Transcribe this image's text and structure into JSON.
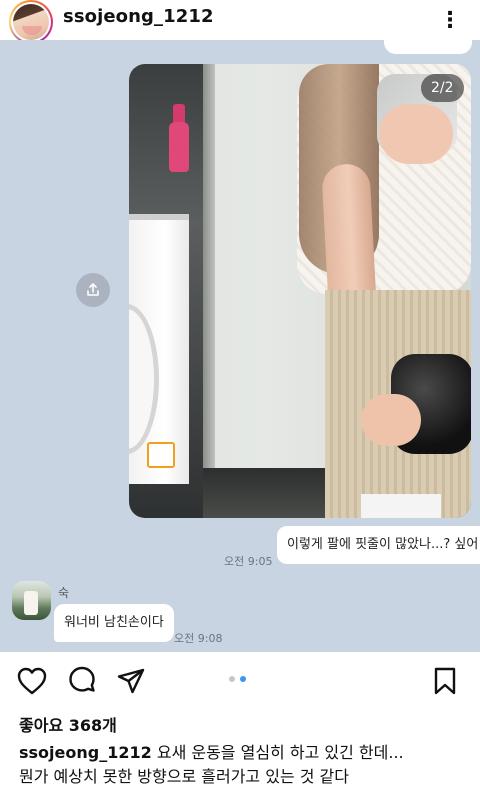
{
  "post": {
    "username": "ssojeong_1212",
    "more_icon": "⋮",
    "likes_text": "좋아요 368개",
    "caption_user": "ssojeong_1212",
    "caption_line1": "요새 운동을 열심히 하고 있긴 한데...",
    "caption_line2": "뭔가 예상치 못한 방향으로 흘러가고 있는 것 같다",
    "carousel": {
      "current": 2,
      "total": 2
    }
  },
  "dm": {
    "photo_counter": "2/2",
    "sent_message": "이렇게 팔에 핏줄이 많았나...? 싶어",
    "sent_time": "오전 9:05",
    "friend_name": "숙",
    "received_message": "워너비 남친손이다",
    "received_time": "오전 9:08"
  },
  "colors": {
    "dm_background": "#c9d4e3",
    "carousel_dot_active": "#3897f0",
    "carousel_dot_inactive": "#c7c7c7"
  },
  "icons": [
    "more-icon",
    "heart-icon",
    "comment-icon",
    "send-icon",
    "bookmark-icon",
    "share-icon"
  ]
}
